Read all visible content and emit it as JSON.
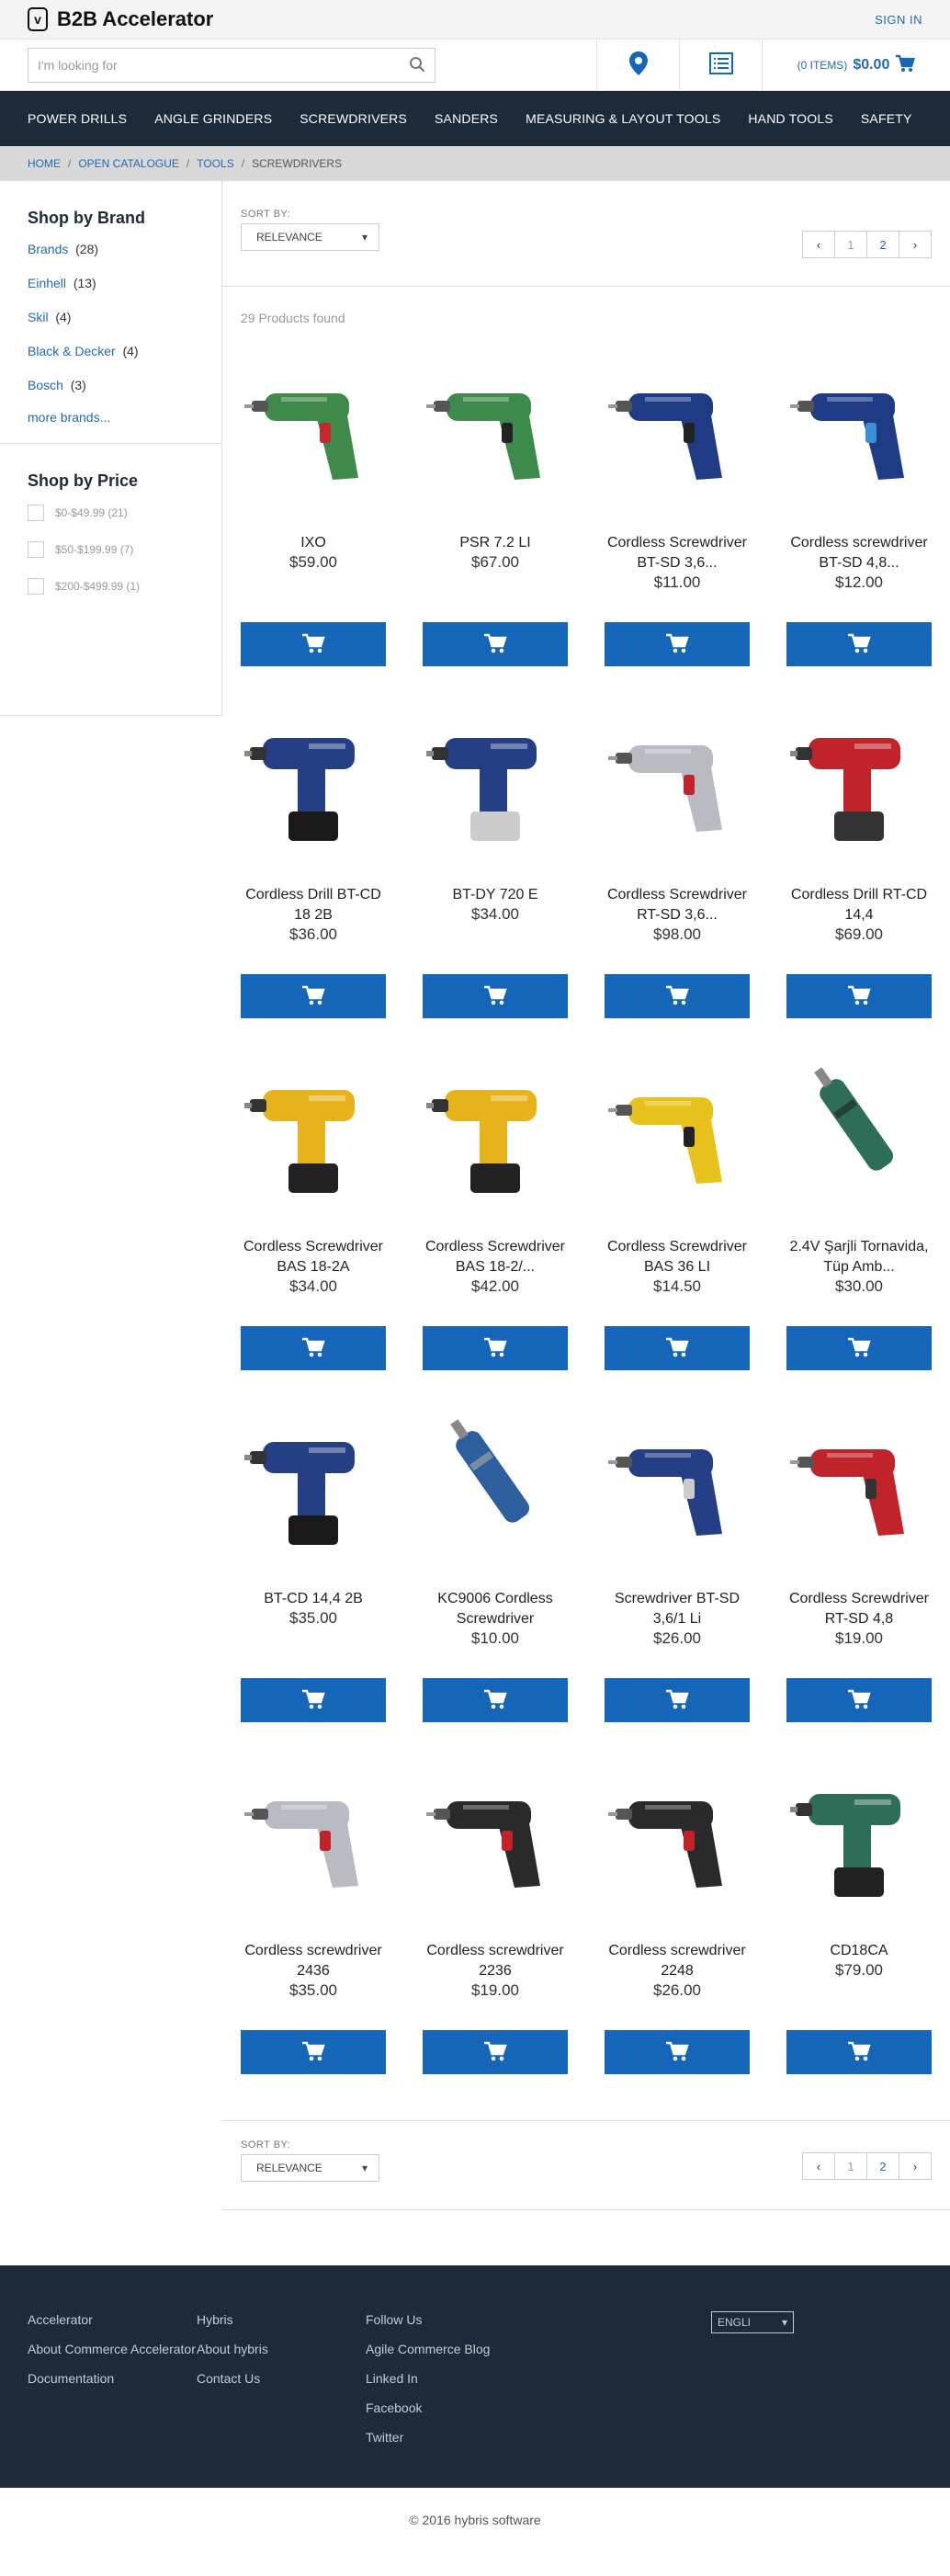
{
  "header": {
    "logo_text": "B2B Accelerator",
    "signin_label": "SIGN IN",
    "search_placeholder": "I'm looking for",
    "cart_items": "(0 ITEMS)",
    "cart_total": "$0.00"
  },
  "nav": [
    "POWER DRILLS",
    "ANGLE GRINDERS",
    "SCREWDRIVERS",
    "SANDERS",
    "MEASURING & LAYOUT TOOLS",
    "HAND TOOLS",
    "SAFETY"
  ],
  "breadcrumb": {
    "home": "HOME",
    "catalogue": "OPEN CATALOGUE",
    "tools": "TOOLS",
    "current": "SCREWDRIVERS",
    "sep": "/"
  },
  "sidebar": {
    "brand_title": "Shop by Brand",
    "brands": [
      {
        "name": "Brands",
        "count": "(28)"
      },
      {
        "name": "Einhell",
        "count": "(13)"
      },
      {
        "name": "Skil",
        "count": "(4)"
      },
      {
        "name": "Black & Decker",
        "count": "(4)"
      },
      {
        "name": "Bosch",
        "count": "(3)"
      }
    ],
    "more_brands": "more brands...",
    "price_title": "Shop by Price",
    "prices": [
      {
        "label": "$0-$49.99",
        "count": "(21)"
      },
      {
        "label": "$50-$199.99",
        "count": "(7)"
      },
      {
        "label": "$200-$499.99",
        "count": "(1)"
      }
    ]
  },
  "sort": {
    "label": "SORT BY:",
    "value": "RELEVANCE",
    "pages": [
      "1",
      "2"
    ],
    "current_page": "2"
  },
  "products_found": "29 Products found",
  "products": [
    {
      "name": "IXO",
      "price": "$59.00",
      "color": "#3f8a4a",
      "accent": "#c4282b",
      "kind": "driver"
    },
    {
      "name": "PSR 7.2 LI",
      "price": "$67.00",
      "color": "#3e8a4d",
      "accent": "#222222",
      "kind": "driver"
    },
    {
      "name": "Cordless Screwdriver BT-SD 3,6...",
      "price": "$11.00",
      "color": "#1f3b86",
      "accent": "#222222",
      "kind": "driver"
    },
    {
      "name": "Cordless screwdriver BT-SD 4,8...",
      "price": "$12.00",
      "color": "#1f3b86",
      "accent": "#3a8fd6",
      "kind": "driver"
    },
    {
      "name": "Cordless Drill BT-CD 18 2B",
      "price": "$36.00",
      "color": "#253f86",
      "accent": "#1a1a1a",
      "kind": "drill"
    },
    {
      "name": "BT-DY 720 E",
      "price": "$34.00",
      "color": "#253f86",
      "accent": "#cccccc",
      "kind": "drill"
    },
    {
      "name": "Cordless Screwdriver RT-SD 3,6...",
      "price": "$98.00",
      "color": "#b8bcc2",
      "accent": "#c0232a",
      "kind": "driver"
    },
    {
      "name": "Cordless Drill RT-CD 14,4",
      "price": "$69.00",
      "color": "#c0232a",
      "accent": "#333333",
      "kind": "drill"
    },
    {
      "name": "Cordless Screwdriver BAS 18-2A",
      "price": "$34.00",
      "color": "#e8b21c",
      "accent": "#222222",
      "kind": "drill"
    },
    {
      "name": "Cordless Screwdriver BAS 18-2/...",
      "price": "$42.00",
      "color": "#e8b21c",
      "accent": "#222222",
      "kind": "drill"
    },
    {
      "name": "Cordless Screwdriver BAS 36 LI",
      "price": "$14.50",
      "color": "#e8c21c",
      "accent": "#222222",
      "kind": "driver"
    },
    {
      "name": "2.4V Şarjli Tornavida, Tüp Amb...",
      "price": "$30.00",
      "color": "#2e6e58",
      "accent": "#222222",
      "kind": "stick"
    },
    {
      "name": "BT-CD 14,4 2B",
      "price": "$35.00",
      "color": "#253f86",
      "accent": "#1a1a1a",
      "kind": "drill"
    },
    {
      "name": "KC9006 Cordless Screwdriver",
      "price": "$10.00",
      "color": "#2d5f9e",
      "accent": "#aaaaaa",
      "kind": "stick"
    },
    {
      "name": "Screwdriver BT-SD 3,6/1 Li",
      "price": "$26.00",
      "color": "#253f86",
      "accent": "#cccccc",
      "kind": "driver"
    },
    {
      "name": "Cordless Screwdriver RT-SD 4,8",
      "price": "$19.00",
      "color": "#c0232a",
      "accent": "#333333",
      "kind": "driver"
    },
    {
      "name": "Cordless screwdriver 2436",
      "price": "$35.00",
      "color": "#b8bcc2",
      "accent": "#c0232a",
      "kind": "driver"
    },
    {
      "name": "Cordless screwdriver 2236",
      "price": "$19.00",
      "color": "#2a2a2a",
      "accent": "#c0232a",
      "kind": "driver"
    },
    {
      "name": "Cordless screwdriver 2248",
      "price": "$26.00",
      "color": "#2a2a2a",
      "accent": "#c0232a",
      "kind": "driver"
    },
    {
      "name": "CD18CA",
      "price": "$79.00",
      "color": "#2e6e58",
      "accent": "#222222",
      "kind": "drill"
    }
  ],
  "footer": {
    "col1": [
      "Accelerator",
      "About Commerce Accelerator",
      "Documentation"
    ],
    "col2": [
      "Hybris",
      "About hybris",
      "Contact Us"
    ],
    "col3": [
      "Follow Us",
      "Agile Commerce Blog",
      "Linked In",
      "Facebook",
      "Twitter"
    ],
    "language": "ENGLI",
    "copyright": "© 2016 hybris software"
  },
  "colors": {
    "brand_blue": "#1565b8",
    "nav_bg": "#1c2a39",
    "link": "#2469b4"
  }
}
